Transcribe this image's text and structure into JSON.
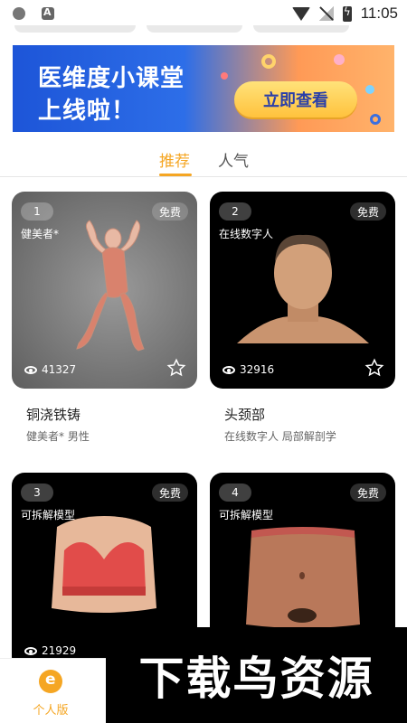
{
  "status_bar": {
    "time": "11:05"
  },
  "banner": {
    "line1": "医维度小课堂",
    "line2": "上线啦！",
    "button": "立即查看"
  },
  "tabs": [
    {
      "label": "推荐",
      "active": true
    },
    {
      "label": "人气",
      "active": false
    }
  ],
  "cards": [
    {
      "number": "1",
      "badge": "免费",
      "label": "健美者*",
      "views": "41327",
      "title": "铜浇铁铸",
      "subtitle": "健美者* 男性"
    },
    {
      "number": "2",
      "badge": "免费",
      "label": "在线数字人",
      "views": "32916",
      "title": "头颈部",
      "subtitle": "在线数字人 局部解剖学"
    },
    {
      "number": "3",
      "badge": "免费",
      "label": "可拆解模型",
      "views": "21929"
    },
    {
      "number": "4",
      "badge": "免费",
      "label": "可拆解模型"
    }
  ],
  "bottom_nav": {
    "label": "个人版"
  },
  "watermark": {
    "text": "下载鸟资源"
  },
  "colors": {
    "accent": "#f5a623",
    "banner_blue": "#2d6ee8",
    "banner_orange": "#ff9a56"
  }
}
